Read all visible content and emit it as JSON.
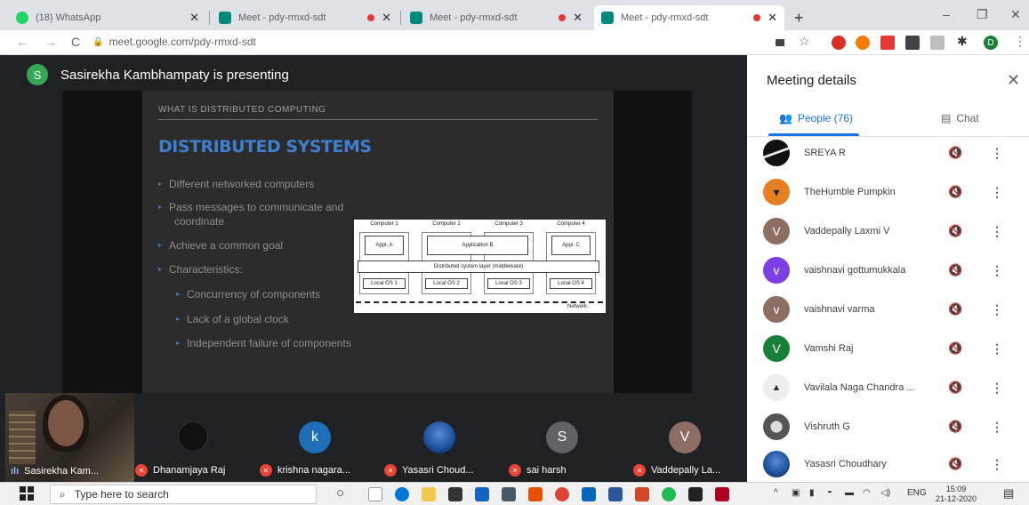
{
  "browser": {
    "tabs": [
      {
        "title": "(18) WhatsApp",
        "favicon_color": "#25d366",
        "recording": false,
        "active": false
      },
      {
        "title": "Meet - pdy-rmxd-sdt",
        "favicon_color": "#00897b",
        "recording": true,
        "active": false
      },
      {
        "title": "Meet - pdy-rmxd-sdt",
        "favicon_color": "#00897b",
        "recording": true,
        "active": false
      },
      {
        "title": "Meet - pdy-rmxd-sdt",
        "favicon_color": "#00897b",
        "recording": true,
        "active": true
      }
    ],
    "new_tab": "+",
    "window_controls": [
      "–",
      "❐",
      "✕"
    ],
    "url": "meet.google.com/pdy-rmxd-sdt",
    "profile_initial": "D",
    "nav": {
      "back": "←",
      "forward": "→",
      "reload": "C"
    }
  },
  "stage": {
    "presenter_initial": "S",
    "presenter_text": "Sasirekha Kambhampaty is presenting"
  },
  "slide": {
    "kicker": "WHAT IS DISTRIBUTED COMPUTING",
    "title": "DISTRIBUTED SYSTEMS",
    "bullets": [
      {
        "text": "Different networked computers",
        "level": 1
      },
      {
        "text": "Pass messages to communicate and",
        "level": 1
      },
      {
        "text": "coordinate",
        "level": 1
      },
      {
        "text": "Achieve a common goal",
        "level": 1
      },
      {
        "text": "Characteristics:",
        "level": 1
      },
      {
        "text": "Concurrency of components",
        "level": 2
      },
      {
        "text": "Lack of a global clock",
        "level": 2
      },
      {
        "text": "Independent failure of components",
        "level": 2
      }
    ],
    "diagram": {
      "computers": [
        "Computer 1",
        "Computer 2",
        "Computer 3",
        "Computer 4"
      ],
      "apps": [
        "Appl. A",
        "Application B",
        "Appl. C"
      ],
      "middleware": "Distributed system layer (middleware)",
      "os": [
        "Local OS 1",
        "Local OS 2",
        "Local OS 3",
        "Local OS 4"
      ],
      "network": "Network"
    }
  },
  "tiles": [
    {
      "name": "Sasirekha Kam...",
      "initial": "",
      "color": "",
      "muted": false
    },
    {
      "name": "Dhanamjaya Raj",
      "initial": "",
      "color": "#111111",
      "muted": true
    },
    {
      "name": "krishna nagara...",
      "initial": "k",
      "color": "#1e6fb8",
      "muted": true
    },
    {
      "name": "Yasasri Choud...",
      "initial": "",
      "color": "#1d4f9a",
      "muted": true
    },
    {
      "name": "sai harsh",
      "initial": "S",
      "color": "#5f6368",
      "muted": true
    },
    {
      "name": "Vaddepally La...",
      "initial": "V",
      "color": "#8d6e63",
      "muted": true
    }
  ],
  "panel": {
    "title": "Meeting details",
    "close": "✕",
    "people_tab": "People (76)",
    "chat_tab": "Chat",
    "participants": [
      {
        "name": "SREYA R",
        "initial": "",
        "color": "#111111"
      },
      {
        "name": "TheHumble Pumpkin",
        "initial": "",
        "color": "#e67e22"
      },
      {
        "name": "Vaddepally Laxmi V",
        "initial": "V",
        "color": "#8d6e63"
      },
      {
        "name": "vaishnavi gottumukkala",
        "initial": "v",
        "color": "#7b3fe4"
      },
      {
        "name": "vaishnavi varma",
        "initial": "v",
        "color": "#8d6e63"
      },
      {
        "name": "Vamshi Raj",
        "initial": "V",
        "color": "#188038"
      },
      {
        "name": "Vavilala Naga Chandra ...",
        "initial": "",
        "color": "#eeeeee"
      },
      {
        "name": "Vishruth G",
        "initial": "",
        "color": "#555555"
      },
      {
        "name": "Yasasri Choudhary",
        "initial": "",
        "color": "#1d4f9a"
      }
    ]
  },
  "taskbar": {
    "search_placeholder": "Type here to search",
    "time": "15:09",
    "date": "21-12-2020",
    "lang": "ENG"
  }
}
